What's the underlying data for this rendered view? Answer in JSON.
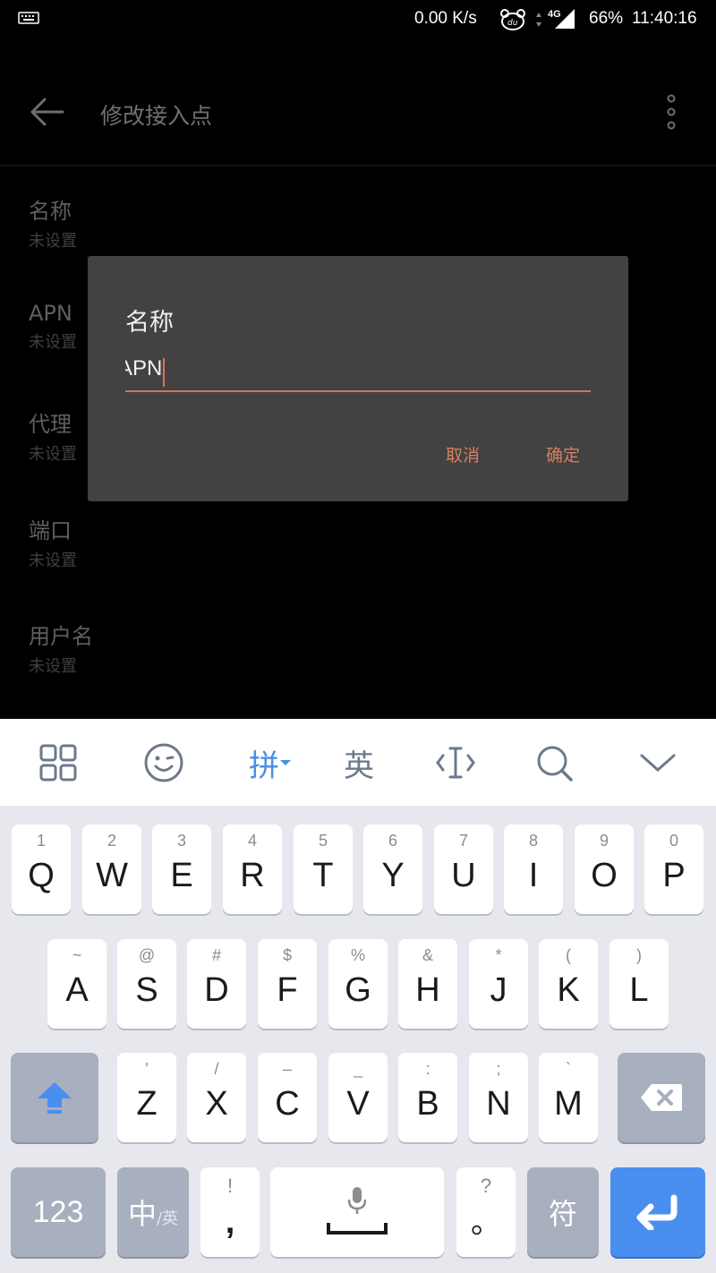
{
  "status_bar": {
    "speed": "0.00 K/s",
    "network_type": "4G",
    "battery": "66%",
    "time": "11:40:16"
  },
  "app_bar": {
    "title": "修改接入点"
  },
  "settings_list": [
    {
      "label": "名称",
      "value": "未设置"
    },
    {
      "label": "APN",
      "value": "未设置"
    },
    {
      "label": "代理",
      "value": "未设置"
    },
    {
      "label": "端口",
      "value": "未设置"
    },
    {
      "label": "用户名",
      "value": "未设置"
    }
  ],
  "dialog": {
    "title": "名称",
    "input_value": "APN",
    "cancel_label": "取消",
    "ok_label": "确定"
  },
  "keyboard": {
    "toolbar": {
      "pinyin_label": "拼",
      "english_label": "英"
    },
    "row1": [
      {
        "sub": "1",
        "main": "Q"
      },
      {
        "sub": "2",
        "main": "W"
      },
      {
        "sub": "3",
        "main": "E"
      },
      {
        "sub": "4",
        "main": "R"
      },
      {
        "sub": "5",
        "main": "T"
      },
      {
        "sub": "6",
        "main": "Y"
      },
      {
        "sub": "7",
        "main": "U"
      },
      {
        "sub": "8",
        "main": "I"
      },
      {
        "sub": "9",
        "main": "O"
      },
      {
        "sub": "0",
        "main": "P"
      }
    ],
    "row2": [
      {
        "sub": "~",
        "main": "A"
      },
      {
        "sub": "@",
        "main": "S"
      },
      {
        "sub": "#",
        "main": "D"
      },
      {
        "sub": "$",
        "main": "F"
      },
      {
        "sub": "%",
        "main": "G"
      },
      {
        "sub": "&",
        "main": "H"
      },
      {
        "sub": "*",
        "main": "J"
      },
      {
        "sub": "(",
        "main": "K"
      },
      {
        "sub": ")",
        "main": "L"
      }
    ],
    "row3": [
      {
        "sub": "'",
        "main": "Z"
      },
      {
        "sub": "/",
        "main": "X"
      },
      {
        "sub": "–",
        "main": "C"
      },
      {
        "sub": "_",
        "main": "V"
      },
      {
        "sub": ":",
        "main": "B"
      },
      {
        "sub": ";",
        "main": "N"
      },
      {
        "sub": "`",
        "main": "M"
      }
    ],
    "row4": {
      "num_label": "123",
      "zh_label": "中",
      "en_small": "/英",
      "comma_sub": "!",
      "comma_main": ",",
      "period_sub": "?",
      "period_main": "。",
      "symbol_label": "符"
    }
  },
  "colors": {
    "accent": "#d97f5f",
    "keyboard_blue": "#4a8ef0",
    "dialog_bg": "#424242"
  }
}
